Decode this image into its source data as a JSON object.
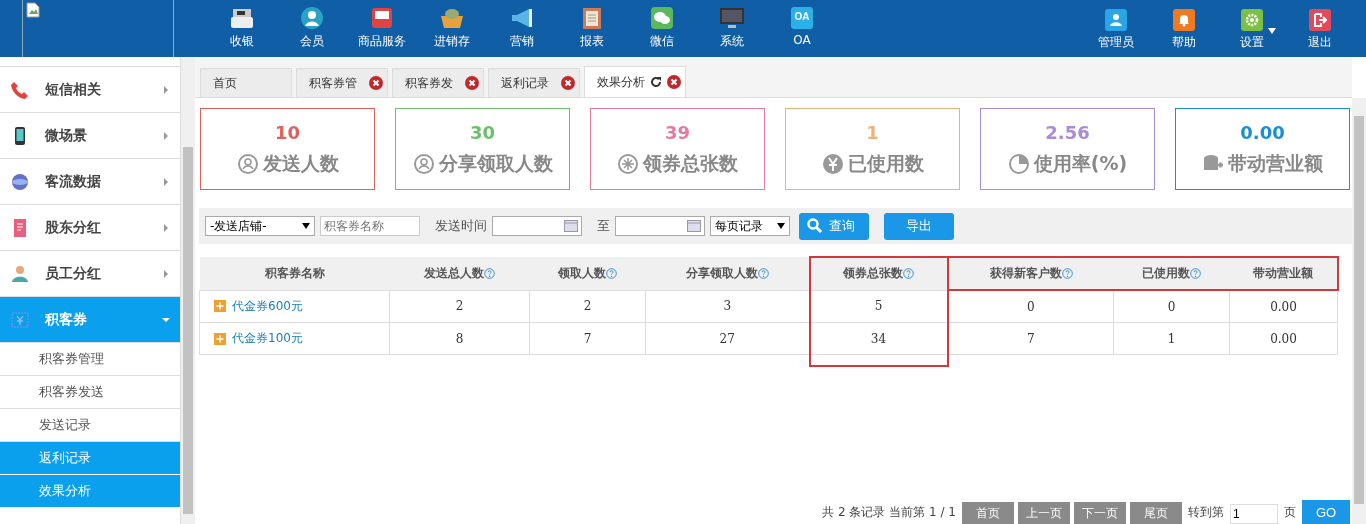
{
  "topnav": {
    "items": [
      {
        "label": "收银",
        "kind": "register"
      },
      {
        "label": "会员",
        "kind": "person"
      },
      {
        "label": "商品服务",
        "kind": "card"
      },
      {
        "label": "进销存",
        "kind": "basket"
      },
      {
        "label": "营销",
        "kind": "megaphone"
      },
      {
        "label": "报表",
        "kind": "clipboard"
      },
      {
        "label": "微信",
        "kind": "chat"
      },
      {
        "label": "系统",
        "kind": "monitor"
      },
      {
        "label": "OA",
        "kind": "oa",
        "badge": "OA"
      }
    ],
    "right": [
      {
        "label": "管理员",
        "kind": "user",
        "color": "#2aa6e8",
        "dropdown": false
      },
      {
        "label": "帮助",
        "kind": "bell",
        "color": "#ee7b22",
        "dropdown": false
      },
      {
        "label": "设置",
        "kind": "gear",
        "color": "#7cc144",
        "dropdown": true
      },
      {
        "label": "退出",
        "kind": "exit",
        "color": "#e04a5a",
        "dropdown": false
      }
    ]
  },
  "sidebar": {
    "items": [
      {
        "label": "短信相关",
        "kind": "phone",
        "expanded": false,
        "selected": false
      },
      {
        "label": "微场景",
        "kind": "mobile",
        "expanded": false,
        "selected": false
      },
      {
        "label": "客流数据",
        "kind": "globe",
        "expanded": false,
        "selected": false
      },
      {
        "label": "股东分红",
        "kind": "doc",
        "expanded": false,
        "selected": false
      },
      {
        "label": "员工分红",
        "kind": "staff",
        "expanded": false,
        "selected": false
      },
      {
        "label": "积客券",
        "kind": "yen",
        "expanded": true,
        "selected": true,
        "children": [
          {
            "label": "积客券管理",
            "selected": false
          },
          {
            "label": "积客券发送",
            "selected": false
          },
          {
            "label": "发送记录",
            "selected": false
          },
          {
            "label": "返利记录",
            "selected": true
          },
          {
            "label": "效果分析",
            "selected": true
          }
        ]
      }
    ]
  },
  "tabs": [
    {
      "label": "首页",
      "selected": false,
      "closable": false,
      "refresh": false
    },
    {
      "label": "积客券管",
      "selected": false,
      "closable": true,
      "refresh": false
    },
    {
      "label": "积客券发",
      "selected": false,
      "closable": true,
      "refresh": false
    },
    {
      "label": "返利记录",
      "selected": false,
      "closable": true,
      "refresh": false
    },
    {
      "label": "效果分析",
      "selected": true,
      "closable": true,
      "refresh": true
    }
  ],
  "stats": [
    {
      "value": "10",
      "label": "发送人数",
      "kind": "person",
      "color": "#e0605a"
    },
    {
      "value": "30",
      "label": "分享领取人数",
      "kind": "person",
      "color": "#6cbf6c"
    },
    {
      "value": "39",
      "label": "领券总张数",
      "kind": "flower",
      "color": "#e879a0"
    },
    {
      "value": "1",
      "label": "已使用数",
      "kind": "yen",
      "color": "#f0b07a"
    },
    {
      "value": "2.56",
      "label": "使用率(%)",
      "kind": "pie",
      "color": "#a98bd8"
    },
    {
      "value": "0.00",
      "label": "带动营业额",
      "kind": "coins",
      "color": "#1b8fd0"
    }
  ],
  "filters": {
    "store": "-发送店铺-",
    "name_placeholder": "积客券名称",
    "time_label": "发送时间",
    "to_label": "至",
    "per_page": "每页记录",
    "search_button": "查询",
    "export_button": "导出"
  },
  "table": {
    "columns": [
      {
        "label": "积客券名称",
        "help": false,
        "kind": "plain"
      },
      {
        "label": "发送总人数",
        "help": true,
        "kind": "plain"
      },
      {
        "label": "领取人数",
        "help": true,
        "kind": "plain"
      },
      {
        "label": "分享领取人数",
        "help": true,
        "kind": "plain"
      },
      {
        "label": "领券总张数",
        "help": true,
        "kind": "boxed-column"
      },
      {
        "label": "获得新客户数",
        "help": true,
        "kind": "boxed-header"
      },
      {
        "label": "已使用数",
        "help": true,
        "kind": "boxed-header"
      },
      {
        "label": "带动营业额",
        "help": false,
        "kind": "boxed-header"
      }
    ],
    "rows": [
      [
        "代金券600元",
        "2",
        "2",
        "3",
        "5",
        "0",
        "0",
        "0.00"
      ],
      [
        "代金券100元",
        "8",
        "7",
        "27",
        "34",
        "7",
        "1",
        "0.00"
      ]
    ]
  },
  "pagination": {
    "summary": "共 2 条记录 当前第 1 / 1",
    "buttons": [
      "首页",
      "上一页",
      "下一页",
      "尾页"
    ],
    "goto_label": "转到第",
    "page_value": "1",
    "page_suffix": "页",
    "go_button": "GO"
  }
}
